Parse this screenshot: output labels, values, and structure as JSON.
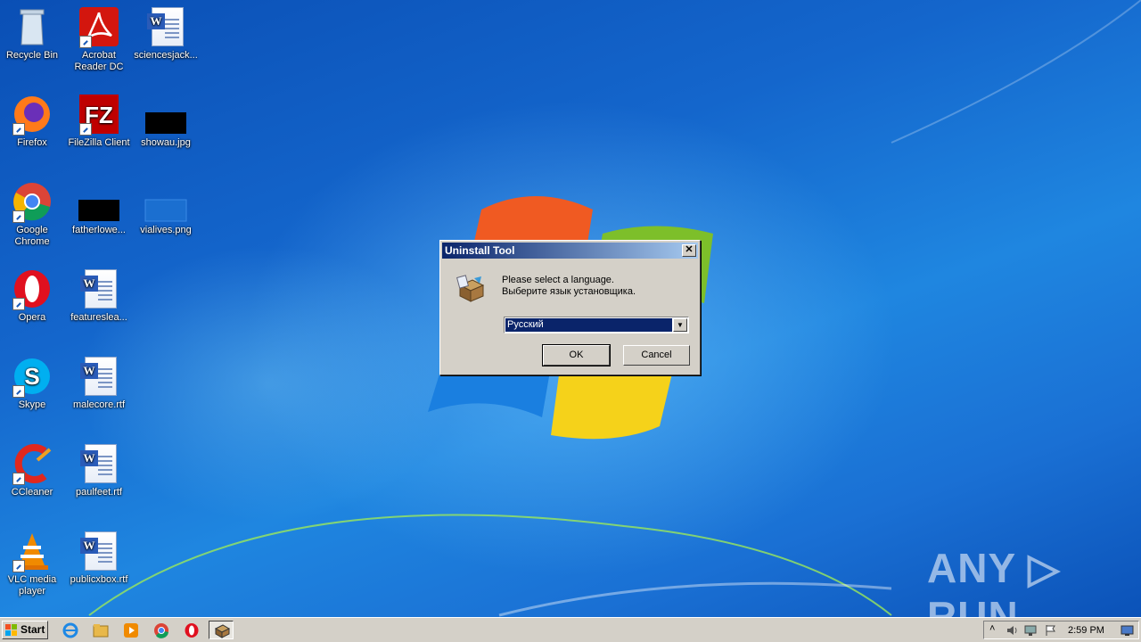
{
  "desktop": {
    "icons": [
      {
        "label": "Recycle Bin"
      },
      {
        "label": "Acrobat Reader DC"
      },
      {
        "label": "sciencesjack..."
      },
      {
        "label": "Firefox"
      },
      {
        "label": "FileZilla Client"
      },
      {
        "label": "showau.jpg"
      },
      {
        "label": "Google Chrome"
      },
      {
        "label": "fatherlowe..."
      },
      {
        "label": "vialives.png"
      },
      {
        "label": "Opera"
      },
      {
        "label": "featureslea..."
      },
      {
        "label": "Skype"
      },
      {
        "label": "malecore.rtf"
      },
      {
        "label": "CCleaner"
      },
      {
        "label": "paulfeet.rtf"
      },
      {
        "label": "VLC media player"
      },
      {
        "label": "publicxbox.rtf"
      }
    ]
  },
  "dialog": {
    "title": "Uninstall Tool",
    "close_glyph": "✕",
    "message_en": "Please select a language.",
    "message_ru": "Выберите язык установщика.",
    "language_selected": "Русский",
    "dropdown_glyph": "▼",
    "ok_label": "OK",
    "cancel_label": "Cancel"
  },
  "watermark": {
    "text": "ANY ▷ RUN"
  },
  "taskbar": {
    "start_label": "Start",
    "clock": "2:59 PM",
    "tray_arrow": "˄"
  },
  "colors": {
    "titlebar_start": "#0a246a",
    "titlebar_end": "#a6caf0",
    "selection": "#0a246a",
    "system_face": "#d4d0c8"
  }
}
